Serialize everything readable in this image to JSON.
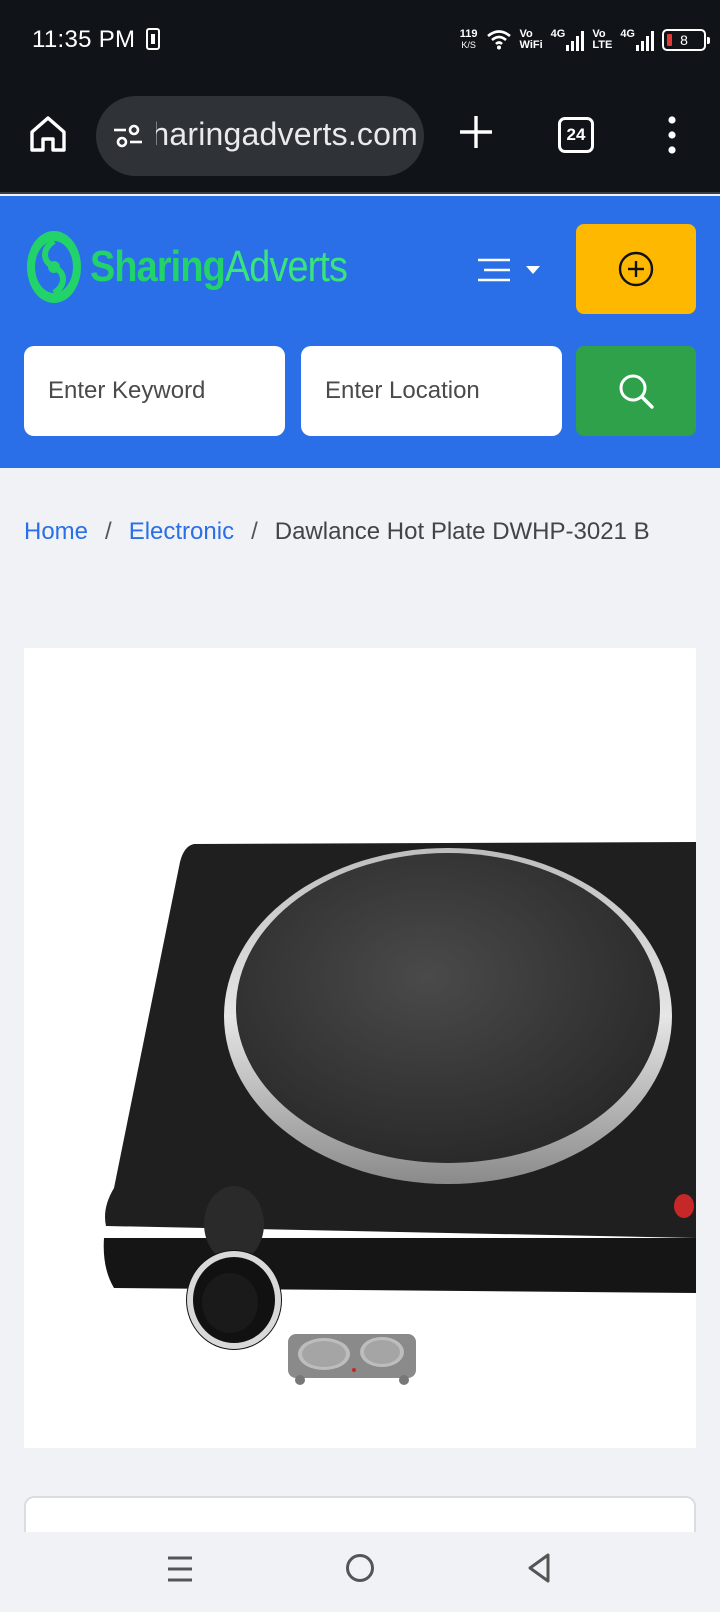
{
  "status_bar": {
    "time": "11:35 PM",
    "net_speed": "119",
    "net_speed_unit": "K/S",
    "vowifi_label_top": "Vo",
    "vowifi_label_bottom": "WiFi",
    "volte_label_top": "Vo",
    "volte_label_bottom": "LTE",
    "sim1_network": "4G",
    "sim2_network": "4G",
    "battery_level": "8",
    "battery_color": "#e53935"
  },
  "browser": {
    "url": "sharingadverts.com",
    "tab_count": "24",
    "icons": [
      "home-icon",
      "tune-icon",
      "plus-icon",
      "tabs-icon",
      "more-vert-icon"
    ]
  },
  "header": {
    "logo_text_1": "Sharing",
    "logo_text_2": "Adverts",
    "brand_color": "#2b6fe8",
    "accent_color": "#ffb800",
    "search_button_color": "#2fa14a",
    "search": {
      "keyword_placeholder": "Enter Keyword",
      "location_placeholder": "Enter Location"
    }
  },
  "breadcrumb": {
    "items": [
      "Home",
      "Electronic",
      "Dawlance Hot Plate DWHP-3021 B"
    ],
    "separator": "/"
  },
  "gallery": {
    "main_image_alt": "Dawlance Hot Plate DWHP-3021 B",
    "thumbnail_count": 1
  }
}
